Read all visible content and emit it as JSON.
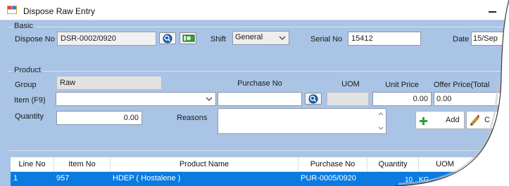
{
  "window": {
    "title": "Dispose Raw Entry"
  },
  "basic": {
    "group_label": "Basic",
    "dispose_no_label": "Dispose No",
    "dispose_no_value": "DSR-0002/0920",
    "shift_label": "Shift",
    "shift_value": "General",
    "serial_no_label": "Serial No",
    "serial_no_value": "15412",
    "date_label": "Date",
    "date_value": "15/Sep"
  },
  "product": {
    "group_label": "Product",
    "group_field_label": "Group",
    "group_value": "Raw",
    "item_label": "Item (F9)",
    "item_value": "",
    "purchase_no_label": "Purchase No",
    "purchase_no_value": "",
    "uom_label": "UOM",
    "uom_value": "",
    "unit_price_label": "Unit Price",
    "unit_price_value": "0.00",
    "offer_price_label": "Offer Price(Total",
    "offer_price_value": "0.00",
    "quantity_label": "Quantity",
    "quantity_value": "0.00",
    "reasons_label": "Reasons",
    "reasons_value": "",
    "add_label": "Add",
    "second_button_label": "C"
  },
  "grid": {
    "columns": [
      "Line No",
      "Item No",
      "Product Name",
      "Purchase No",
      "Quantity",
      "UOM"
    ],
    "rows": [
      {
        "line_no": "1",
        "item_no": "957",
        "product_name": "HDEP ( Hostalene )",
        "purchase_no": "PUR-0005/0920",
        "quantity": "10",
        "uom": "KG"
      }
    ]
  },
  "icons": {
    "app": "form-window-icon",
    "search": "search-icon",
    "money": "money-icon",
    "add": "plus-icon",
    "edit": "pencil-icon"
  },
  "colors": {
    "form_background": "#a9c4e5",
    "selected_row": "#0a7be0",
    "add_icon": "#2e9e3a"
  }
}
